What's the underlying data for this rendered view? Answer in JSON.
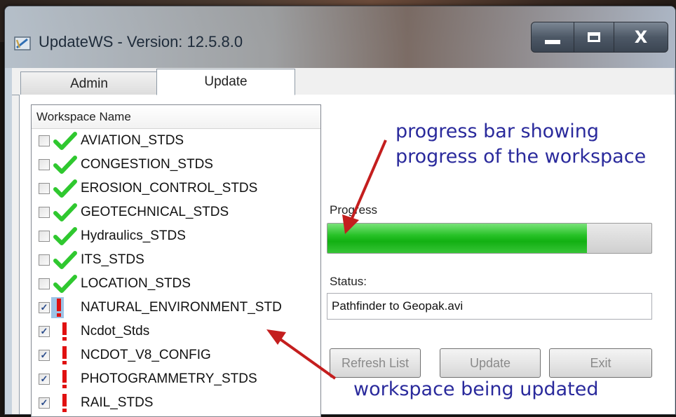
{
  "window": {
    "title": "UpdateWS - Version: 12.5.8.0",
    "controls": {
      "minimize": "minimize",
      "maximize": "maximize",
      "close": "X"
    }
  },
  "tabs": [
    {
      "label": "Admin",
      "selected": false
    },
    {
      "label": "Update",
      "selected": true
    }
  ],
  "workspace_list": {
    "header": "Workspace Name",
    "items": [
      {
        "name": "AVIATION_STDS",
        "checked": false,
        "status": "done"
      },
      {
        "name": "CONGESTION_STDS",
        "checked": false,
        "status": "done"
      },
      {
        "name": "EROSION_CONTROL_STDS",
        "checked": false,
        "status": "done"
      },
      {
        "name": "GEOTECHNICAL_STDS",
        "checked": false,
        "status": "done"
      },
      {
        "name": "Hydraulics_STDS",
        "checked": false,
        "status": "done"
      },
      {
        "name": "ITS_STDS",
        "checked": false,
        "status": "done"
      },
      {
        "name": "LOCATION_STDS",
        "checked": false,
        "status": "done"
      },
      {
        "name": "NATURAL_ENVIRONMENT_STD",
        "checked": true,
        "status": "updating"
      },
      {
        "name": "Ncdot_Stds",
        "checked": true,
        "status": "pending"
      },
      {
        "name": "NCDOT_V8_CONFIG",
        "checked": true,
        "status": "pending"
      },
      {
        "name": "PHOTOGRAMMETRY_STDS",
        "checked": true,
        "status": "pending"
      },
      {
        "name": "RAIL_STDS",
        "checked": true,
        "status": "pending"
      }
    ]
  },
  "progress": {
    "label": "Progress",
    "value_fraction": 0.8
  },
  "status": {
    "label": "Status:",
    "value": "Pathfinder to Geopak.avi"
  },
  "buttons": {
    "refresh": "Refresh List",
    "update": "Update",
    "exit": "Exit"
  },
  "annotations": {
    "progress_note_line1": "progress bar showing",
    "progress_note_line2": "progress of the workspace",
    "workspace_note": "workspace being updated"
  },
  "colors": {
    "done_check": "#2fc82f",
    "pending_mark": "#e01010",
    "progress_fill": "#1fba1f",
    "annotation_text": "#2a2a9c",
    "annotation_arrow": "#c41e1e"
  }
}
